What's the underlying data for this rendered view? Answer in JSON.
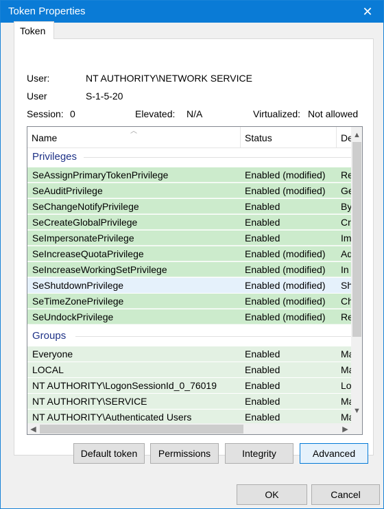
{
  "window": {
    "title": "Token Properties",
    "close_glyph": "✕"
  },
  "tabs": [
    {
      "label": "Token",
      "selected": true
    }
  ],
  "info": {
    "user_label": "User:",
    "user_value": "NT AUTHORITY\\NETWORK SERVICE",
    "user_sid_label": "User",
    "user_sid_value": "S-1-5-20",
    "session_label": "Session:",
    "session_value": "0",
    "elevated_label": "Elevated:",
    "elevated_value": "N/A",
    "virtualized_label": "Virtualized:",
    "virtualized_value": "Not allowed"
  },
  "list": {
    "columns": [
      "Name",
      "Status",
      "De"
    ],
    "groups": {
      "privileges": "Privileges",
      "groups": "Groups"
    },
    "privileges": [
      {
        "name": "SeAssignPrimaryTokenPrivilege",
        "status": "Enabled (modified)",
        "desc": "Re"
      },
      {
        "name": "SeAuditPrivilege",
        "status": "Enabled (modified)",
        "desc": "Ge"
      },
      {
        "name": "SeChangeNotifyPrivilege",
        "status": "Enabled",
        "desc": "By"
      },
      {
        "name": "SeCreateGlobalPrivilege",
        "status": "Enabled",
        "desc": "Cr"
      },
      {
        "name": "SeImpersonatePrivilege",
        "status": "Enabled",
        "desc": "Im"
      },
      {
        "name": "SeIncreaseQuotaPrivilege",
        "status": "Enabled (modified)",
        "desc": "Ad"
      },
      {
        "name": "SeIncreaseWorkingSetPrivilege",
        "status": "Enabled (modified)",
        "desc": "In"
      },
      {
        "name": "SeShutdownPrivilege",
        "status": "Enabled (modified)",
        "desc": "Sh"
      },
      {
        "name": "SeTimeZonePrivilege",
        "status": "Enabled (modified)",
        "desc": "Ch"
      },
      {
        "name": "SeUndockPrivilege",
        "status": "Enabled (modified)",
        "desc": "Re"
      }
    ],
    "group_rows": [
      {
        "name": "Everyone",
        "status": "Enabled",
        "desc": "Ma"
      },
      {
        "name": "LOCAL",
        "status": "Enabled",
        "desc": "Ma"
      },
      {
        "name": "NT AUTHORITY\\LogonSessionId_0_76019",
        "status": "Enabled",
        "desc": "Lo"
      },
      {
        "name": "NT AUTHORITY\\SERVICE",
        "status": "Enabled",
        "desc": "Ma"
      },
      {
        "name": "NT AUTHORITY\\Authenticated Users",
        "status": "Enabled",
        "desc": "Ma"
      }
    ]
  },
  "buttons": {
    "default_token": "Default token",
    "permissions": "Permissions",
    "integrity": "Integrity",
    "advanced": "Advanced",
    "ok": "OK",
    "cancel": "Cancel"
  },
  "colors": {
    "titlebar": "#0a7bd6",
    "enabled_row": "#ccebcc",
    "selected_row": "#e5f1fb",
    "group_header": "#1e3287"
  },
  "icons": {
    "close": "close-icon",
    "sort": "sort-up-arrow-icon",
    "scroll_up": "scroll-up-arrow-icon",
    "scroll_down": "scroll-down-arrow-icon",
    "scroll_left": "scroll-left-arrow-icon",
    "scroll_right": "scroll-right-arrow-icon"
  }
}
